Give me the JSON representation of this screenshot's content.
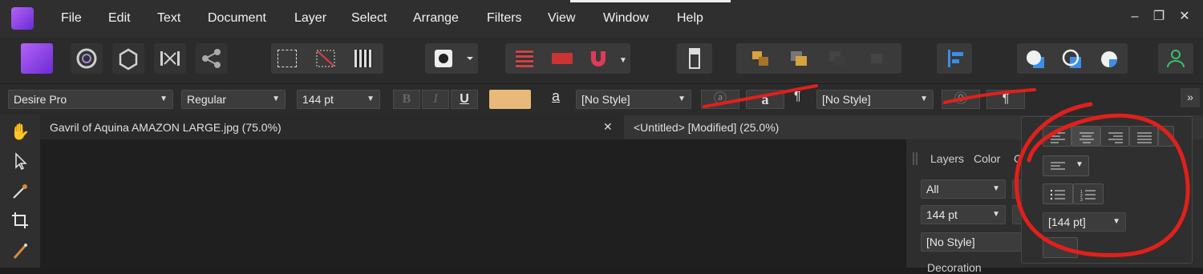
{
  "menu": [
    "File",
    "Edit",
    "Text",
    "Document",
    "Layer",
    "Select",
    "Arrange",
    "Filters",
    "View",
    "Window",
    "Help"
  ],
  "window_controls": {
    "minimize": "–",
    "restore": "❐",
    "close": "✕"
  },
  "context": {
    "font_family": "Desire Pro",
    "font_style": "Regular",
    "font_size": "144 pt",
    "bold": "B",
    "italic": "I",
    "underline": "U",
    "char_style_icon": "a",
    "char_style": "[No Style]",
    "char_style_btn2": "a",
    "para_style_icon": "¶",
    "para_style": "[No Style]",
    "para_btn": "¶",
    "overflow": "»"
  },
  "tabs": [
    {
      "label": "Gavril of Aquina AMAZON LARGE.jpg (75.0%)",
      "close": "✕"
    },
    {
      "label": "<Untitled> [Modified] (25.0%)"
    }
  ],
  "studio": {
    "tabs": [
      "Layers",
      "Color",
      "C"
    ],
    "blend": "All",
    "size": "144 pt",
    "style": "[No Style]",
    "section": "Decoration"
  },
  "popover": {
    "leading": "[144 pt]"
  },
  "colors": {
    "accent": "#8a3ff0",
    "annotation": "#e0201c",
    "swatch": "#e8b978"
  }
}
